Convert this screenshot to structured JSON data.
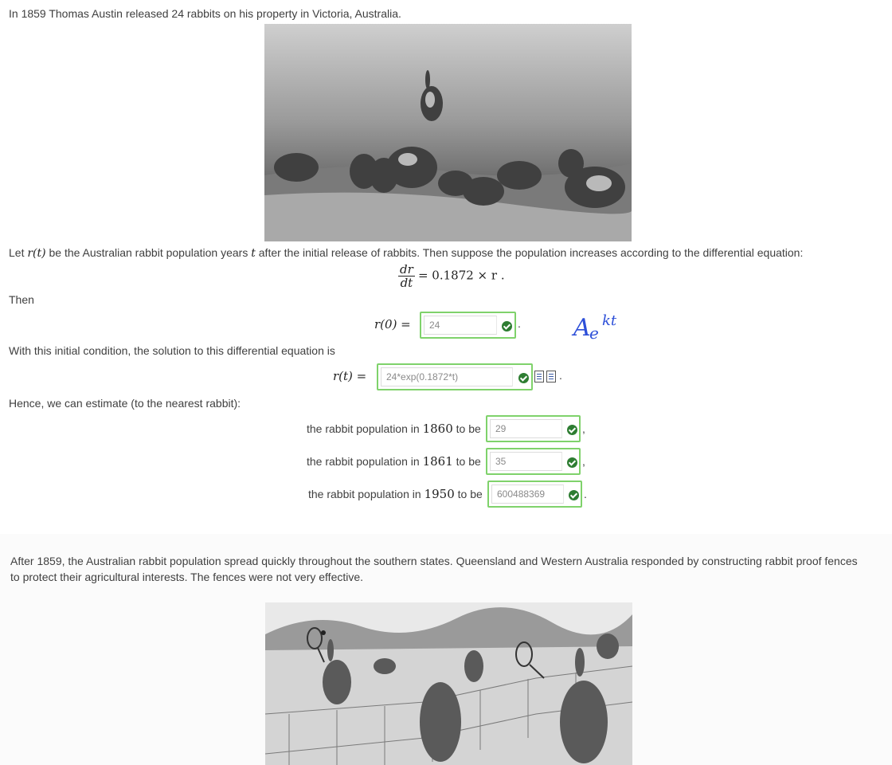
{
  "intro_text": "In 1859 Thomas Austin released 24 rabbits on his property in Victoria, Australia.",
  "definition": {
    "prefix": "Let ",
    "rt": "r(t)",
    "middle": " be the Australian rabbit population years ",
    "t": "t",
    "suffix": " after the initial release of rabbits. Then suppose the population increases according to the differential equation:"
  },
  "equation": {
    "numerator": "dr",
    "denominator": "dt",
    "rhs": "= 0.1872 × r ."
  },
  "then_label": "Then",
  "initial_condition": {
    "label": "r(0) =",
    "value": "24",
    "trailing": "."
  },
  "handwriting": {
    "base": "A",
    "e": "e",
    "exponent": "kt"
  },
  "solution_intro": "With this initial condition, the solution to this differential equation is",
  "solution": {
    "label": "r(t) =",
    "value": "24*exp(0.1872*t)",
    "trailing": "."
  },
  "estimate_intro": "Hence, we can estimate (to the nearest rabbit):",
  "estimates": [
    {
      "prefix": "the rabbit population in ",
      "year": "1860",
      "suffix": " to be",
      "value": "29",
      "trailing": ","
    },
    {
      "prefix": "the rabbit population in ",
      "year": "1861",
      "suffix": " to be",
      "value": "35",
      "trailing": ","
    },
    {
      "prefix": "the rabbit population in ",
      "year": "1950",
      "suffix": " to be",
      "value": "600488369",
      "trailing": "."
    }
  ],
  "spread_text_line1": "After 1859, the Australian rabbit population spread quickly throughout the southern states. Queensland and Western Australia responded by constructing rabbit proof fences",
  "spread_text_line2": "to protect their agricultural interests. The fences were not very effective.",
  "colors": {
    "correct_border": "#7fd26b",
    "check_green": "#2e7d32",
    "handwriting_blue": "#2d4fd8"
  }
}
